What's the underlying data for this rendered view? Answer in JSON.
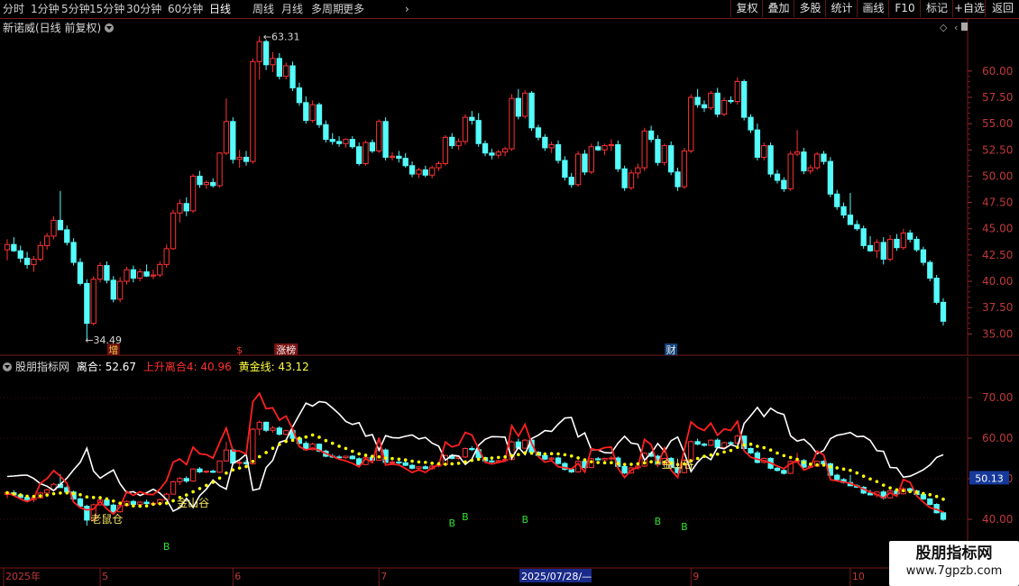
{
  "toolbar": {
    "periods": [
      "分时",
      "1分钟",
      "5分钟",
      "15分钟",
      "30分钟",
      "60分钟",
      "日线",
      "周线",
      "月线",
      "多周期",
      "更多"
    ],
    "active_period": "日线",
    "buttons": [
      "复权",
      "叠加",
      "多股",
      "统计",
      "画线",
      "F10",
      "标记",
      "+自选",
      "返回"
    ]
  },
  "stock": {
    "title": "新诺威(日线 前复权)",
    "high_label": "63.31",
    "low_label": "34.49"
  },
  "price_axis": [
    "60.00",
    "57.50",
    "55.00",
    "52.50",
    "50.00",
    "47.50",
    "45.00",
    "42.50",
    "40.00",
    "37.50",
    "35.00"
  ],
  "event_markers": [
    {
      "label": "增",
      "color": "#e8c040",
      "bg": "#6a1010"
    },
    {
      "label": "$",
      "color": "#ff3030",
      "bg": ""
    },
    {
      "label": "涨榜",
      "color": "#f0f0f0",
      "bg": "#7a1515"
    },
    {
      "label": "财",
      "color": "#f0f0f0",
      "bg": "#13417a"
    }
  ],
  "indicator": {
    "name": "股朋指标网",
    "line1_label": "离合: 52.67",
    "line2_label": "上升离合4: 40.96",
    "line3_label": "黄金线: 43.12",
    "value_badge": "50.13",
    "annotations": [
      "老鼠仓",
      "金山谷",
      "金山谷"
    ],
    "buy_marks": [
      "B",
      "B",
      "B",
      "B",
      "B",
      "B"
    ]
  },
  "indicator_axis": [
    "70.00",
    "60.00",
    "50.00",
    "40.00"
  ],
  "date_axis": {
    "labels": [
      "2025年",
      "5",
      "6",
      "7",
      "9",
      "10"
    ],
    "cursor": "2025/07/28/—"
  },
  "watermark": {
    "title": "股朋指标网",
    "url": "www.7gpzb.com"
  },
  "colors": {
    "up": "#ff3232",
    "down": "#54fcfc",
    "yellow_line": "#ffff00",
    "white_line": "#ffffff",
    "red_line": "#ff2020",
    "grid": "#7a1a1a"
  },
  "chart_data": {
    "type": "candlestick",
    "ylim": [
      34,
      63.5
    ],
    "candles": [
      [
        43.0,
        44.0,
        42.0,
        43.5
      ],
      [
        43.5,
        44.2,
        42.8,
        42.9
      ],
      [
        42.9,
        43.4,
        41.8,
        42.2
      ],
      [
        42.2,
        42.8,
        41.2,
        41.6
      ],
      [
        41.6,
        42.4,
        40.9,
        42.1
      ],
      [
        42.1,
        43.8,
        41.9,
        43.4
      ],
      [
        43.4,
        44.6,
        43.0,
        44.3
      ],
      [
        44.3,
        46.2,
        44.0,
        45.8
      ],
      [
        45.8,
        48.6,
        45.2,
        44.9
      ],
      [
        44.9,
        45.3,
        43.4,
        43.7
      ],
      [
        43.7,
        44.1,
        41.5,
        41.8
      ],
      [
        41.8,
        42.2,
        39.6,
        39.8
      ],
      [
        39.8,
        40.2,
        34.5,
        36.0
      ],
      [
        36.0,
        40.5,
        35.8,
        40.2
      ],
      [
        40.2,
        41.8,
        39.9,
        41.5
      ],
      [
        41.5,
        41.9,
        39.8,
        40.1
      ],
      [
        40.1,
        40.5,
        38.0,
        38.3
      ],
      [
        38.3,
        40.4,
        38.0,
        40.0
      ],
      [
        40.0,
        41.4,
        39.7,
        41.1
      ],
      [
        41.1,
        41.5,
        39.9,
        40.3
      ],
      [
        40.3,
        41.2,
        40.0,
        40.9
      ],
      [
        40.9,
        41.6,
        40.4,
        40.5
      ],
      [
        40.5,
        41.1,
        40.2,
        40.6
      ],
      [
        40.6,
        41.9,
        40.4,
        41.6
      ],
      [
        41.6,
        43.5,
        41.3,
        43.1
      ],
      [
        43.1,
        46.8,
        43.0,
        46.5
      ],
      [
        46.5,
        47.8,
        45.6,
        47.4
      ],
      [
        47.4,
        48.0,
        46.2,
        46.7
      ],
      [
        46.7,
        50.2,
        46.5,
        50.0
      ],
      [
        50.0,
        50.5,
        48.9,
        49.2
      ],
      [
        49.2,
        49.6,
        48.8,
        49.4
      ],
      [
        49.4,
        49.8,
        48.9,
        49.1
      ],
      [
        49.1,
        52.3,
        48.9,
        52.2
      ],
      [
        52.2,
        57.4,
        52.0,
        55.2
      ],
      [
        55.2,
        55.6,
        51.2,
        51.6
      ],
      [
        51.6,
        52.5,
        50.8,
        51.8
      ],
      [
        51.8,
        52.4,
        51.0,
        51.4
      ],
      [
        51.4,
        61.2,
        51.2,
        60.9
      ],
      [
        60.9,
        63.3,
        59.2,
        62.8
      ],
      [
        62.8,
        63.0,
        60.1,
        60.6
      ],
      [
        60.6,
        61.8,
        59.9,
        61.2
      ],
      [
        61.2,
        61.7,
        59.2,
        59.5
      ],
      [
        59.5,
        60.8,
        59.2,
        60.5
      ],
      [
        60.5,
        60.9,
        58.1,
        58.4
      ],
      [
        58.4,
        58.9,
        56.7,
        57.0
      ],
      [
        57.0,
        57.6,
        55.0,
        55.3
      ],
      [
        55.3,
        57.2,
        55.1,
        56.8
      ],
      [
        56.8,
        57.0,
        54.6,
        54.9
      ],
      [
        54.9,
        55.3,
        53.2,
        53.5
      ],
      [
        53.5,
        54.1,
        53.0,
        53.3
      ],
      [
        53.3,
        53.8,
        52.8,
        53.1
      ],
      [
        53.1,
        53.6,
        52.7,
        53.5
      ],
      [
        53.5,
        53.8,
        52.6,
        52.8
      ],
      [
        52.8,
        53.2,
        51.0,
        51.2
      ],
      [
        51.2,
        53.4,
        51.0,
        53.2
      ],
      [
        53.2,
        53.5,
        52.2,
        52.4
      ],
      [
        52.4,
        55.4,
        52.2,
        55.2
      ],
      [
        55.2,
        55.6,
        51.5,
        51.8
      ],
      [
        51.8,
        52.3,
        51.5,
        51.9
      ],
      [
        51.9,
        52.4,
        51.3,
        51.7
      ],
      [
        51.7,
        52.2,
        50.8,
        51.0
      ],
      [
        51.0,
        51.4,
        49.9,
        50.2
      ],
      [
        50.2,
        50.8,
        49.8,
        50.6
      ],
      [
        50.6,
        51.0,
        49.9,
        50.1
      ],
      [
        50.1,
        51.0,
        49.8,
        50.8
      ],
      [
        50.8,
        51.4,
        50.5,
        51.2
      ],
      [
        51.2,
        53.9,
        51.0,
        53.7
      ],
      [
        53.7,
        54.1,
        52.6,
        52.9
      ],
      [
        52.9,
        53.6,
        52.5,
        53.3
      ],
      [
        53.3,
        55.9,
        53.0,
        55.6
      ],
      [
        55.6,
        56.2,
        54.9,
        55.3
      ],
      [
        55.3,
        56.0,
        52.8,
        53.1
      ],
      [
        53.1,
        53.4,
        51.9,
        52.2
      ],
      [
        52.2,
        52.6,
        51.6,
        52.0
      ],
      [
        52.0,
        52.5,
        51.7,
        52.3
      ],
      [
        52.3,
        52.8,
        51.9,
        52.6
      ],
      [
        52.6,
        57.8,
        52.4,
        57.4
      ],
      [
        57.4,
        58.3,
        55.4,
        55.7
      ],
      [
        55.7,
        58.2,
        55.5,
        57.9
      ],
      [
        57.9,
        58.1,
        54.3,
        54.6
      ],
      [
        54.6,
        54.9,
        53.4,
        53.7
      ],
      [
        53.7,
        54.0,
        52.4,
        52.7
      ],
      [
        52.7,
        53.3,
        52.2,
        53.0
      ],
      [
        53.0,
        53.4,
        51.2,
        51.5
      ],
      [
        51.5,
        51.9,
        49.6,
        49.9
      ],
      [
        49.9,
        50.3,
        48.9,
        49.2
      ],
      [
        49.2,
        52.4,
        49.0,
        52.1
      ],
      [
        52.1,
        52.5,
        50.1,
        50.4
      ],
      [
        50.4,
        53.1,
        50.2,
        52.8
      ],
      [
        52.8,
        53.3,
        52.4,
        52.5
      ],
      [
        52.5,
        53.1,
        52.0,
        52.9
      ],
      [
        52.9,
        53.5,
        52.4,
        53.0
      ],
      [
        53.0,
        53.4,
        50.4,
        50.7
      ],
      [
        50.7,
        51.0,
        48.6,
        48.9
      ],
      [
        48.9,
        50.6,
        48.7,
        50.3
      ],
      [
        50.3,
        51.2,
        49.8,
        50.8
      ],
      [
        50.8,
        54.6,
        50.5,
        54.3
      ],
      [
        54.3,
        54.8,
        53.2,
        53.5
      ],
      [
        53.5,
        53.9,
        51.0,
        51.3
      ],
      [
        51.3,
        53.1,
        51.0,
        52.9
      ],
      [
        52.9,
        53.3,
        50.1,
        50.4
      ],
      [
        50.4,
        50.8,
        48.6,
        49.0
      ],
      [
        49.0,
        52.7,
        48.8,
        52.4
      ],
      [
        52.4,
        57.8,
        52.2,
        57.5
      ],
      [
        57.5,
        58.3,
        56.5,
        56.8
      ],
      [
        56.8,
        57.2,
        56.1,
        56.5
      ],
      [
        56.5,
        58.1,
        56.3,
        57.9
      ],
      [
        57.9,
        58.4,
        55.6,
        55.9
      ],
      [
        55.9,
        57.5,
        55.7,
        57.2
      ],
      [
        57.2,
        57.6,
        56.9,
        57.1
      ],
      [
        57.1,
        59.4,
        56.8,
        59.0
      ],
      [
        59.0,
        59.2,
        55.3,
        55.6
      ],
      [
        55.6,
        55.9,
        54.1,
        54.4
      ],
      [
        54.4,
        55.0,
        51.5,
        51.8
      ],
      [
        51.8,
        53.2,
        51.5,
        52.9
      ],
      [
        52.9,
        53.2,
        49.9,
        50.2
      ],
      [
        50.2,
        50.6,
        49.3,
        49.6
      ],
      [
        49.6,
        49.9,
        48.5,
        48.8
      ],
      [
        48.8,
        52.4,
        48.6,
        52.1
      ],
      [
        52.1,
        54.4,
        51.9,
        52.3
      ],
      [
        52.3,
        52.7,
        50.2,
        50.5
      ],
      [
        50.5,
        51.1,
        50.2,
        50.8
      ],
      [
        50.8,
        52.3,
        50.6,
        52.1
      ],
      [
        52.1,
        52.4,
        51.1,
        51.4
      ],
      [
        51.4,
        51.8,
        48.0,
        48.3
      ],
      [
        48.3,
        48.7,
        46.8,
        47.1
      ],
      [
        47.1,
        47.5,
        46.0,
        46.3
      ],
      [
        46.3,
        48.4,
        46.0,
        45.4
      ],
      [
        45.4,
        45.8,
        44.8,
        45.0
      ],
      [
        45.0,
        45.3,
        43.1,
        43.4
      ],
      [
        43.4,
        44.3,
        42.8,
        42.9
      ],
      [
        42.9,
        44.0,
        42.2,
        43.7
      ],
      [
        43.7,
        44.2,
        41.6,
        42.1
      ],
      [
        42.1,
        44.4,
        41.9,
        44.0
      ],
      [
        44.0,
        44.5,
        42.9,
        43.2
      ],
      [
        43.2,
        45.0,
        43.0,
        44.6
      ],
      [
        44.6,
        44.9,
        43.7,
        44.0
      ],
      [
        44.0,
        44.3,
        42.8,
        43.0
      ],
      [
        43.0,
        43.3,
        41.5,
        41.8
      ],
      [
        41.8,
        42.0,
        40.0,
        40.3
      ],
      [
        40.3,
        40.6,
        37.8,
        38.0
      ],
      [
        38.0,
        38.4,
        35.8,
        36.2
      ]
    ],
    "indicator_series": [
      {
        "name": "离合",
        "color": "#ffffff"
      },
      {
        "name": "上升离合4",
        "color": "#ff2020"
      },
      {
        "name": "黄金线",
        "color": "#ffff00"
      }
    ],
    "indicator_ylim": [
      28,
      80
    ]
  }
}
